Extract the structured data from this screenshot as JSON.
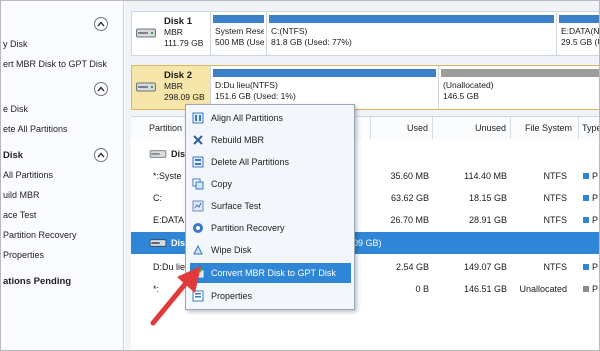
{
  "sidebar": {
    "groups": [
      {
        "title_visible": "",
        "items": [
          "y Disk",
          "ert MBR Disk to GPT Disk"
        ]
      },
      {
        "title_visible": "",
        "items": [
          "e Disk",
          "ete All Partitions"
        ]
      },
      {
        "title_visible": "Disk",
        "items": [
          "All Partitions",
          "uild MBR",
          "ace Test",
          "Partition Recovery",
          "Properties"
        ]
      }
    ],
    "pending": "ations Pending"
  },
  "disks": [
    {
      "name": "Disk 1",
      "scheme": "MBR",
      "size": "111.79 GB",
      "partitions": [
        {
          "line1": "System Rese",
          "line2": "500 MB (Use",
          "bar": "blue"
        },
        {
          "line1": "C:(NTFS)",
          "line2": "81.8 GB (Used: 77%)",
          "bar": "blue"
        },
        {
          "line1": "E:DATA(N",
          "line2": "29.5 GB (U",
          "bar": "blue"
        }
      ]
    },
    {
      "name": "Disk 2",
      "scheme": "MBR",
      "size": "298.09 GB",
      "partitions": [
        {
          "line1": "D:Du lieu(NTFS)",
          "line2": "151.6 GB (Used: 1%)",
          "bar": "blue"
        },
        {
          "line1": "(Unallocated)",
          "line2": "146.5 GB",
          "bar": "gray"
        }
      ]
    }
  ],
  "table": {
    "headers": [
      "Partition",
      "Used",
      "Unused",
      "File System",
      "Type"
    ],
    "rows": [
      {
        "kind": "disk",
        "partition": "Disk",
        "used": "",
        "unused": "",
        "fs": "",
        "type": ""
      },
      {
        "kind": "part",
        "partition": "*:Syste",
        "used": "35.60 MB",
        "unused": "114.40 MB",
        "fs": "NTFS",
        "type": "P"
      },
      {
        "kind": "part",
        "partition": "C:",
        "used": "63.62 GB",
        "unused": "18.15 GB",
        "fs": "NTFS",
        "type": "P"
      },
      {
        "kind": "part",
        "partition": "E:DATA",
        "used": "26.70 MB",
        "unused": "28.91 GB",
        "fs": "NTFS",
        "type": "P"
      },
      {
        "kind": "disk-sel",
        "partition": "Disk",
        "used": "09 GB)",
        "unused": "",
        "fs": "",
        "type": ""
      },
      {
        "kind": "part",
        "partition": "D:Du lie",
        "used": "2.54 GB",
        "unused": "149.07 GB",
        "fs": "NTFS",
        "type": "P"
      },
      {
        "kind": "part",
        "partition": "*:",
        "used": "0 B",
        "unused": "146.51 GB",
        "fs": "Unallocated",
        "type": "P"
      }
    ]
  },
  "menu": {
    "items": [
      {
        "label": "Align All Partitions",
        "icon": "align-icon"
      },
      {
        "label": "Rebuild MBR",
        "icon": "rebuild-icon"
      },
      {
        "label": "Delete All Partitions",
        "icon": "delete-icon"
      },
      {
        "label": "Copy",
        "icon": "copy-icon"
      },
      {
        "label": "Surface Test",
        "icon": "surface-test-icon"
      },
      {
        "label": "Partition Recovery",
        "icon": "recovery-icon"
      },
      {
        "label": "Wipe Disk",
        "icon": "wipe-icon"
      },
      {
        "label": "Convert MBR Disk to GPT Disk",
        "icon": "convert-icon"
      },
      {
        "label": "Properties",
        "icon": "properties-icon"
      }
    ],
    "highlighted": "Convert MBR Disk to GPT Disk"
  },
  "colors": {
    "accent": "#2f86d6",
    "selected_disk": "#f7e6a9",
    "used_bar": "#3c80c7",
    "unallocated_bar": "#9c9c9c",
    "arrow": "#e03a3a"
  }
}
